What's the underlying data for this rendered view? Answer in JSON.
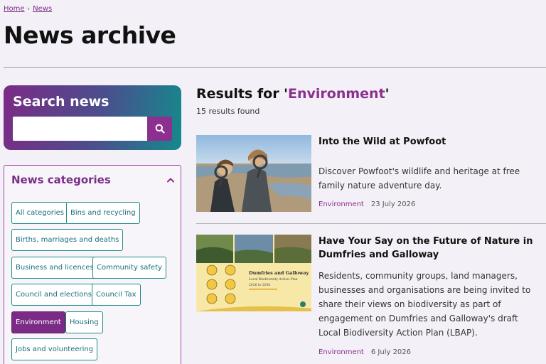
{
  "breadcrumb": {
    "home": "Home",
    "separator": "›",
    "news": "News"
  },
  "page": {
    "title": "News archive"
  },
  "search": {
    "title": "Search news",
    "placeholder": "",
    "value": "",
    "button_icon": "search-icon"
  },
  "categories": {
    "title": "News categories",
    "toggle_icon": "chevron-up-icon",
    "items": [
      {
        "label": "All categories",
        "active": false
      },
      {
        "label": "Bins and recycling",
        "active": false
      },
      {
        "label": "Births, marriages and deaths",
        "active": false
      },
      {
        "label": "Business and licences",
        "active": false
      },
      {
        "label": "Community safety",
        "active": false
      },
      {
        "label": "Council and elections",
        "active": false
      },
      {
        "label": "Council Tax",
        "active": false
      },
      {
        "label": "Environment",
        "active": true
      },
      {
        "label": "Housing",
        "active": false
      },
      {
        "label": "Jobs and volunteering",
        "active": false
      }
    ]
  },
  "results": {
    "prefix": "Results for '",
    "term": "Environment",
    "suffix": "'",
    "count": "15 results found",
    "articles": [
      {
        "title": "Into the Wild at Powfoot",
        "summary": "Discover Powfoot's wildlife and heritage at free family nature adventure day.",
        "category": "Environment",
        "date": "23 July 2026"
      },
      {
        "title": "Have Your Say on the Future of Nature in Dumfries and Galloway",
        "summary": "Residents, community groups, land managers, businesses and organisations are being invited to share their views on biodiversity as part of engagement on Dumfries and Galloway's draft Local Biodiversity Action Plan (LBAP).",
        "category": "Environment",
        "date": "6 July 2026",
        "image_text": {
          "title": "Dumfries and Galloway",
          "subtitle": "Local Biodiversity Action Plan",
          "years": "2026 to 2036"
        }
      }
    ]
  },
  "colors": {
    "brand_purple": "#7b2b86",
    "brand_teal": "#148a8c",
    "link": "#8c2f8f"
  }
}
